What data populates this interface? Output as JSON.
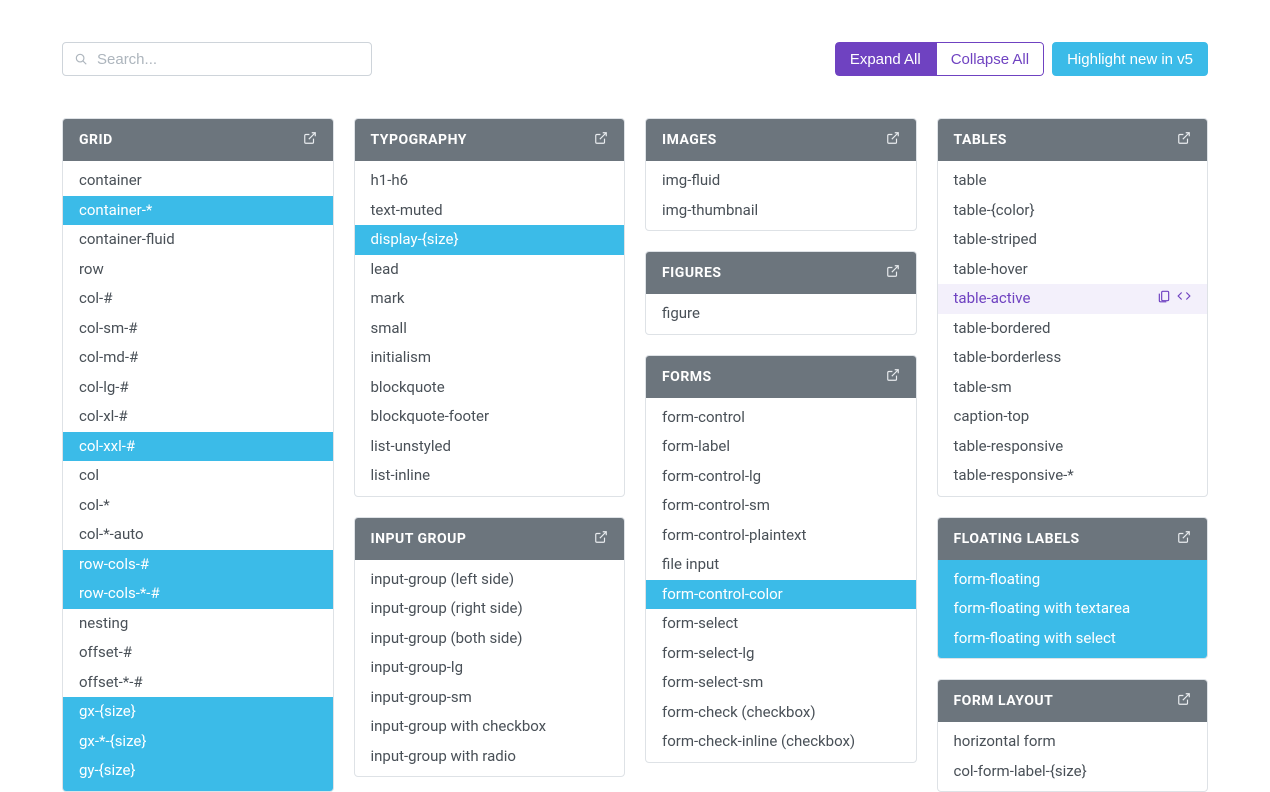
{
  "toolbar": {
    "search_placeholder": "Search...",
    "expand_all_label": "Expand All",
    "collapse_all_label": "Collapse All",
    "highlight_new_label": "Highlight new in v5"
  },
  "columns": [
    [
      {
        "title": "GRID",
        "items": [
          {
            "t": "container"
          },
          {
            "t": "container-*",
            "hl": true
          },
          {
            "t": "container-fluid"
          },
          {
            "t": "row"
          },
          {
            "t": "col-#"
          },
          {
            "t": "col-sm-#"
          },
          {
            "t": "col-md-#"
          },
          {
            "t": "col-lg-#"
          },
          {
            "t": "col-xl-#"
          },
          {
            "t": "col-xxl-#",
            "hl": true
          },
          {
            "t": "col"
          },
          {
            "t": "col-*"
          },
          {
            "t": "col-*-auto"
          },
          {
            "t": "row-cols-#",
            "hl": true
          },
          {
            "t": "row-cols-*-#",
            "hl": true
          },
          {
            "t": "nesting"
          },
          {
            "t": "offset-#"
          },
          {
            "t": "offset-*-#"
          },
          {
            "t": "gx-{size}",
            "hl": true
          },
          {
            "t": "gx-*-{size}",
            "hl": true
          },
          {
            "t": "gy-{size}",
            "hl": true
          }
        ]
      }
    ],
    [
      {
        "title": "TYPOGRAPHY",
        "items": [
          {
            "t": "h1-h6"
          },
          {
            "t": "text-muted"
          },
          {
            "t": "display-{size}",
            "hl": true
          },
          {
            "t": "lead"
          },
          {
            "t": "mark"
          },
          {
            "t": "small"
          },
          {
            "t": "initialism"
          },
          {
            "t": "blockquote"
          },
          {
            "t": "blockquote-footer"
          },
          {
            "t": "list-unstyled"
          },
          {
            "t": "list-inline"
          }
        ]
      },
      {
        "title": "INPUT GROUP",
        "items": [
          {
            "t": "input-group (left side)"
          },
          {
            "t": "input-group (right side)"
          },
          {
            "t": "input-group (both side)"
          },
          {
            "t": "input-group-lg"
          },
          {
            "t": "input-group-sm"
          },
          {
            "t": "input-group with checkbox"
          },
          {
            "t": "input-group with radio"
          }
        ]
      }
    ],
    [
      {
        "title": "IMAGES",
        "items": [
          {
            "t": "img-fluid"
          },
          {
            "t": "img-thumbnail"
          }
        ]
      },
      {
        "title": "FIGURES",
        "items": [
          {
            "t": "figure"
          }
        ]
      },
      {
        "title": "FORMS",
        "items": [
          {
            "t": "form-control"
          },
          {
            "t": "form-label"
          },
          {
            "t": "form-control-lg"
          },
          {
            "t": "form-control-sm"
          },
          {
            "t": "form-control-plaintext"
          },
          {
            "t": "file input"
          },
          {
            "t": "form-control-color",
            "hl": true
          },
          {
            "t": "form-select"
          },
          {
            "t": "form-select-lg"
          },
          {
            "t": "form-select-sm"
          },
          {
            "t": "form-check (checkbox)"
          },
          {
            "t": "form-check-inline (checkbox)"
          }
        ]
      }
    ],
    [
      {
        "title": "TABLES",
        "items": [
          {
            "t": "table"
          },
          {
            "t": "table-{color}"
          },
          {
            "t": "table-striped"
          },
          {
            "t": "table-hover"
          },
          {
            "t": "table-active",
            "hover": true
          },
          {
            "t": "table-bordered"
          },
          {
            "t": "table-borderless"
          },
          {
            "t": "table-sm"
          },
          {
            "t": "caption-top"
          },
          {
            "t": "table-responsive"
          },
          {
            "t": "table-responsive-*"
          }
        ]
      },
      {
        "title": "FLOATING LABELS",
        "items": [
          {
            "t": "form-floating",
            "hl": true
          },
          {
            "t": "form-floating with textarea",
            "hl": true
          },
          {
            "t": "form-floating with select",
            "hl": true
          }
        ]
      },
      {
        "title": "FORM LAYOUT",
        "items": [
          {
            "t": "horizontal form"
          },
          {
            "t": "col-form-label-{size}"
          }
        ]
      }
    ]
  ]
}
